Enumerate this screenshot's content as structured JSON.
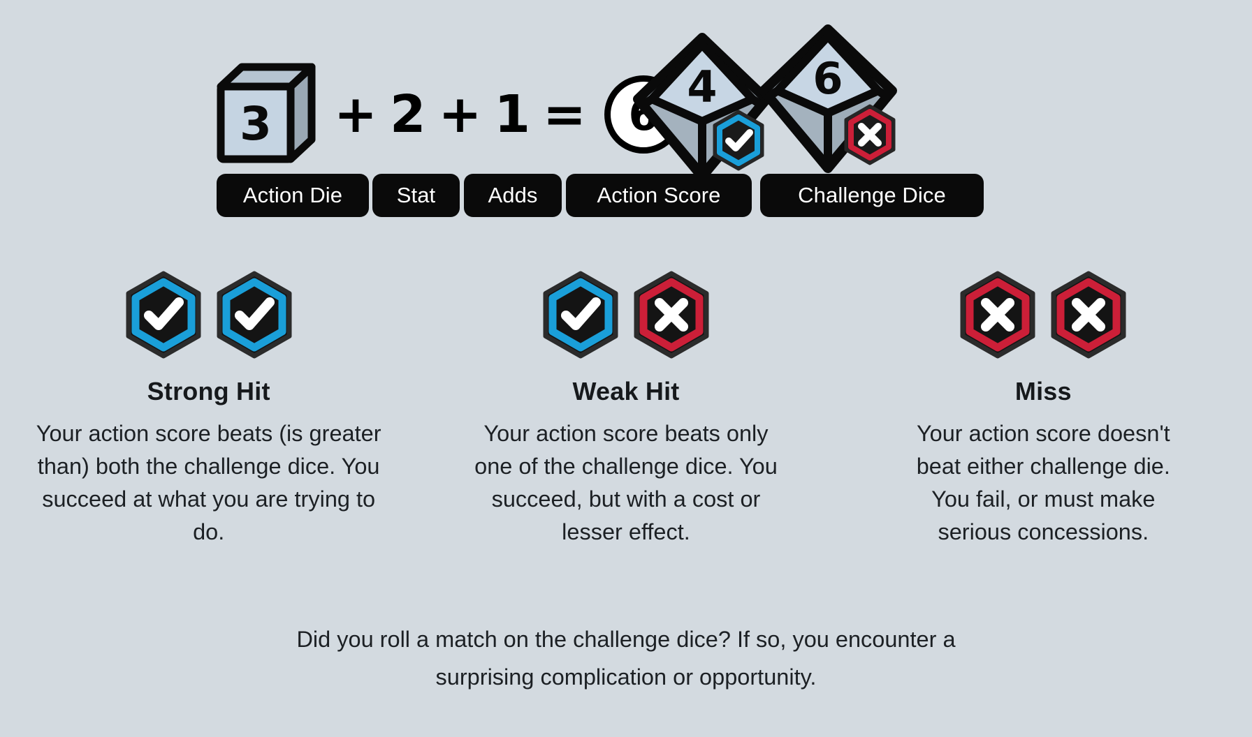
{
  "formula": {
    "action_die": {
      "icon": "cube-die-icon",
      "value": "3"
    },
    "plus_1": "+",
    "stat": "2",
    "plus_2": "+",
    "adds": "1",
    "equals": "=",
    "action_score": {
      "icon": "circle-icon",
      "value": "6"
    },
    "challenge_dice": [
      {
        "icon": "d10-die-icon",
        "value": "4",
        "badge": "check-icon",
        "badge_color": "#1a9fd9"
      },
      {
        "icon": "d10-die-icon",
        "value": "6",
        "badge": "cross-icon",
        "badge_color": "#cc1f38"
      }
    ]
  },
  "labels": {
    "action_die": "Action Die",
    "stat": "Stat",
    "adds": "Adds",
    "action_score": "Action Score",
    "challenge_dice": "Challenge Dice"
  },
  "results": [
    {
      "key": "strong-hit",
      "title": "Strong Hit",
      "description": "Your action score beats (is greater than) both the challenge dice. You succeed at what you are trying to do.",
      "badges": [
        {
          "icon": "check-icon",
          "color": "#1a9fd9"
        },
        {
          "icon": "check-icon",
          "color": "#1a9fd9"
        }
      ]
    },
    {
      "key": "weak-hit",
      "title": "Weak Hit",
      "description": "Your action score beats only one of the challenge dice. You succeed, but with a cost or lesser effect.",
      "badges": [
        {
          "icon": "check-icon",
          "color": "#1a9fd9"
        },
        {
          "icon": "cross-icon",
          "color": "#cc1f38"
        }
      ]
    },
    {
      "key": "miss",
      "title": "Miss",
      "description": "Your action score doesn't beat either challenge die. You fail, or must make serious concessions.",
      "badges": [
        {
          "icon": "cross-icon",
          "color": "#cc1f38"
        },
        {
          "icon": "cross-icon",
          "color": "#cc1f38"
        }
      ]
    }
  ],
  "footer": {
    "note": "Did you roll a match on the challenge dice? If so, you encounter a surprising complication or opportunity."
  },
  "colors": {
    "background": "#d3dae0",
    "pill_background": "#0a0a0a",
    "pill_text": "#ffffff",
    "blue": "#1a9fd9",
    "red": "#cc1f38",
    "die_face_light": "#c5d4e2",
    "die_face_mid": "#a8b4bf",
    "die_face_dark": "#94a2ae",
    "outline": "#0a0a0a",
    "text": "#1c2024"
  }
}
